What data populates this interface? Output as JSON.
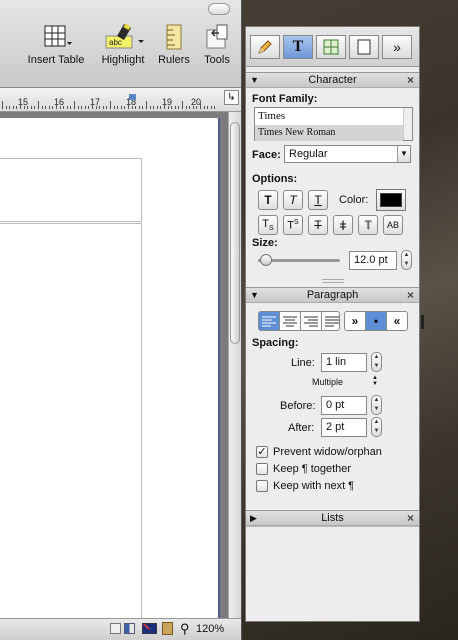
{
  "toolbar": {
    "items": [
      {
        "label": "Insert Table",
        "icon": "table-icon"
      },
      {
        "label": "Highlight",
        "icon": "highlighter-icon"
      },
      {
        "label": "Rulers",
        "icon": "ruler-icon"
      },
      {
        "label": "Tools",
        "icon": "tools-icon"
      }
    ]
  },
  "ruler": {
    "numbers": [
      "15",
      "16",
      "17",
      "18",
      "19",
      "20"
    ]
  },
  "statusbar": {
    "zoom": "120%"
  },
  "inspector": {
    "tabs": [
      "pencil",
      "T",
      "table",
      "page",
      "»"
    ],
    "character": {
      "title": "Character",
      "font_family_label": "Font Family:",
      "fonts": [
        "Times",
        "Times New Roman"
      ],
      "face_label": "Face:",
      "face_value": "Regular",
      "options_label": "Options:",
      "color_label": "Color:",
      "color": "#000000",
      "size_label": "Size:",
      "size_value": "12.0 pt"
    },
    "paragraph": {
      "title": "Paragraph",
      "spacing_label": "Spacing:",
      "line_label": "Line:",
      "line_value": "1 lin",
      "line_mode": "Multiple",
      "before_label": "Before:",
      "before_value": "0 pt",
      "after_label": "After:",
      "after_value": "2 pt",
      "checks": [
        {
          "label": "Prevent widow/orphan",
          "checked": true
        },
        {
          "label": "Keep ¶ together",
          "checked": false
        },
        {
          "label": "Keep with next ¶",
          "checked": false
        }
      ]
    },
    "lists": {
      "title": "Lists"
    }
  }
}
